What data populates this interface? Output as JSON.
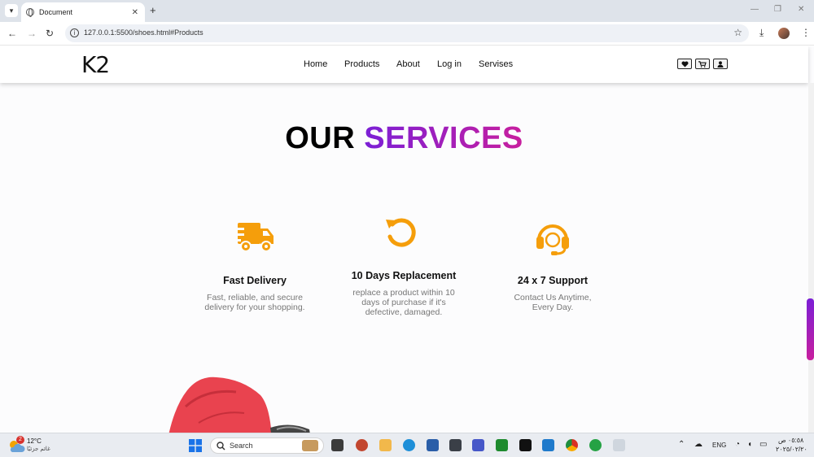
{
  "browser": {
    "tab_title": "Document",
    "url": "127.0.0.1:5500/shoes.html#Products"
  },
  "site": {
    "logo": "K2",
    "menu": [
      "Home",
      "Products",
      "About",
      "Log in",
      "Servises"
    ]
  },
  "services": {
    "heading_dark": "OUR",
    "heading_accent": "SERVICES",
    "items": [
      {
        "icon": "delivery-truck-icon",
        "title": "Fast Delivery",
        "desc": "Fast, reliable, and secure delivery for your shopping."
      },
      {
        "icon": "replacement-arrow-icon",
        "title": "10 Days Replacement",
        "desc": "replace a product within 10 days of purchase if it's defective, damaged."
      },
      {
        "icon": "headset-support-icon",
        "title": "24 x 7 Support",
        "desc": "Contact Us Anytime, Every Day."
      }
    ],
    "icon_color": "#f59e0b",
    "accent_gradient": [
      "#7b1fd6",
      "#c81f9e"
    ]
  },
  "taskbar": {
    "weather_badge": "2",
    "temperature": "12°C",
    "weather_desc": "غائم جزئيًا",
    "search_placeholder": "Search",
    "language": "ENG",
    "time": "٠٥:٥٨ ص",
    "date": "٢٠٢٥/٠٢/٢٠"
  }
}
